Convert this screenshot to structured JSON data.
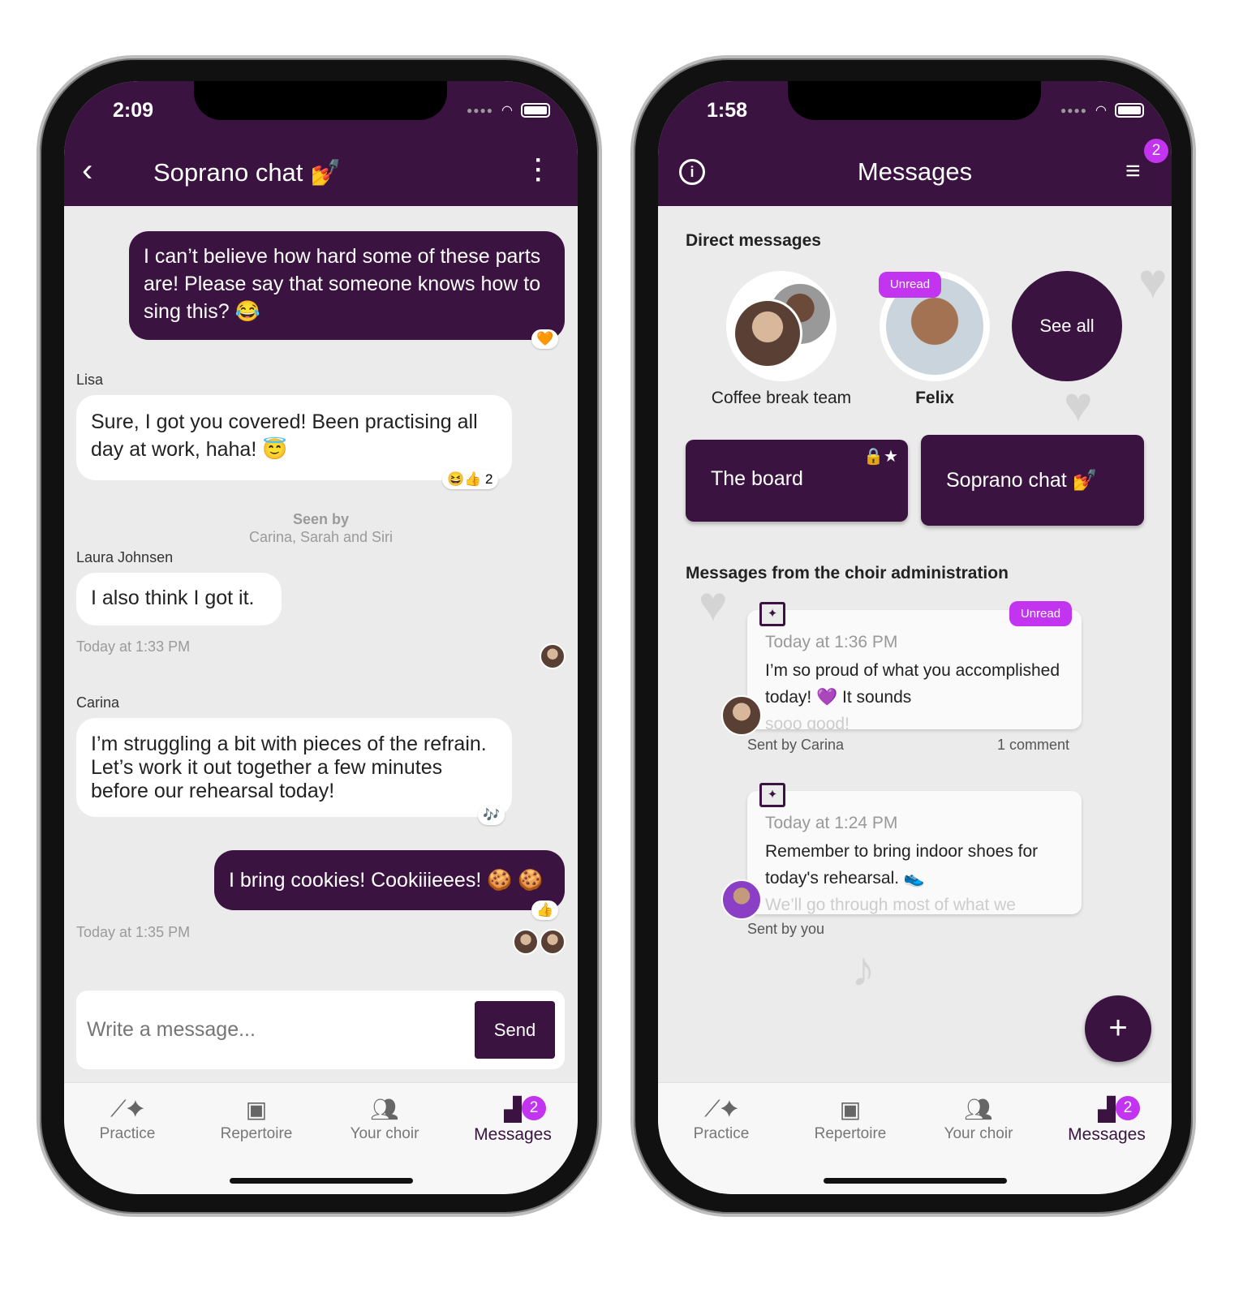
{
  "colors": {
    "brand": "#3b1340",
    "badge": "#c334f0",
    "background": "#ebebeb"
  },
  "chat_screen": {
    "status_time": "2:09",
    "header": {
      "title": "Soprano chat 💅",
      "back_icon": "chevron-left-icon",
      "menu_icon": "more-vertical-icon"
    },
    "messages": [
      {
        "text": "I can’t believe how hard some of these parts are! Please say that someone knows how to sing this? 😂",
        "reactions": "🧡"
      },
      {
        "sender": "Lisa",
        "text": "Sure, I got you covered! Been practising all day at work, haha! 😇",
        "reactions": "😆👍 2"
      },
      {
        "sender": "Laura Johnsen",
        "text": "I also think I got it.",
        "time": "Today at 1:33 PM"
      },
      {
        "sender": "Carina",
        "text": "I’m struggling a bit with pieces of the refrain. Let’s work it out together a few minutes before our rehearsal today!",
        "reactions": "🎶"
      },
      {
        "text": "I bring cookies! Cookiiieees! 🍪 🍪",
        "reactions": "👍",
        "time": "Today at 1:35 PM"
      }
    ],
    "seen_by": {
      "title": "Seen by",
      "names": "Carina, Sarah and Siri"
    },
    "input": {
      "placeholder": "Write a message...",
      "send_label": "Send"
    }
  },
  "messages_screen": {
    "status_time": "1:58",
    "header": {
      "title": "Messages",
      "info_icon": "info-icon",
      "menu_icon": "hamburger-menu-icon",
      "menu_badge": "2"
    },
    "direct_messages": {
      "heading": "Direct messages",
      "items": [
        {
          "name": "Coffee break team"
        },
        {
          "name": "Felix",
          "badge": "Unread"
        }
      ],
      "see_all": "See all"
    },
    "group_chats": [
      {
        "name": "The board",
        "icons": "🔒★"
      },
      {
        "name": "Soprano chat 💅"
      }
    ],
    "admin": {
      "heading": "Messages from the choir administration",
      "posts": [
        {
          "time": "Today at 1:36 PM",
          "text": "I’m so proud of what you accomplished today! 💜  It sounds",
          "fade": "sooo good!",
          "badge": "Unread",
          "sender": "Sent by Carina",
          "comments": "1 comment"
        },
        {
          "time": "Today at 1:24 PM",
          "text": "Remember to bring indoor shoes for today's rehearsal. 👟",
          "fade": "We’ll go through most of what we",
          "sender": "Sent by you"
        }
      ]
    },
    "fab_label": "+"
  },
  "nav": {
    "items": [
      {
        "label": "Practice",
        "icon": "sparkle-chart-icon"
      },
      {
        "label": "Repertoire",
        "icon": "music-library-icon"
      },
      {
        "label": "Your choir",
        "icon": "people-icon"
      },
      {
        "label": "Messages",
        "icon": "chat-icon",
        "badge": "2"
      }
    ]
  }
}
